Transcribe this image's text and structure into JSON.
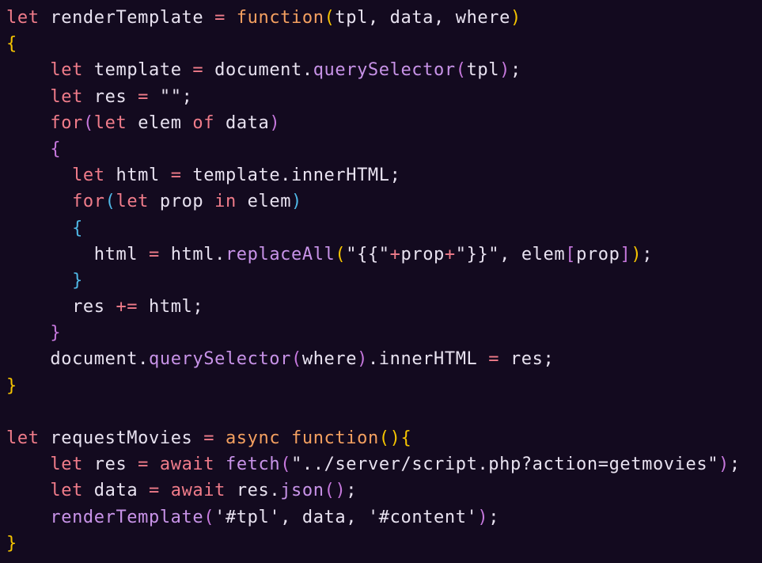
{
  "editor": {
    "lines": [
      [
        [
          "kw",
          "let"
        ],
        [
          "ws",
          " renderTemplate "
        ],
        [
          "op",
          "="
        ],
        [
          "ws",
          " "
        ],
        [
          "fn",
          "function"
        ],
        [
          "p1",
          "("
        ],
        [
          "id",
          "tpl, data, where"
        ],
        [
          "p1",
          ")"
        ]
      ],
      [
        [
          "p1",
          "{"
        ]
      ],
      [
        [
          "ws",
          "    "
        ],
        [
          "kw",
          "let"
        ],
        [
          "ws",
          " template "
        ],
        [
          "op",
          "="
        ],
        [
          "ws",
          " document."
        ],
        [
          "mth",
          "querySelector"
        ],
        [
          "p2",
          "("
        ],
        [
          "id",
          "tpl"
        ],
        [
          "p2",
          ")"
        ],
        [
          "id",
          ";"
        ]
      ],
      [
        [
          "ws",
          "    "
        ],
        [
          "kw",
          "let"
        ],
        [
          "ws",
          " res "
        ],
        [
          "op",
          "="
        ],
        [
          "ws",
          " "
        ],
        [
          "str",
          "\"\""
        ],
        [
          "id",
          ";"
        ]
      ],
      [
        [
          "ws",
          "    "
        ],
        [
          "kw",
          "for"
        ],
        [
          "p2",
          "("
        ],
        [
          "kw",
          "let"
        ],
        [
          "ws",
          " elem "
        ],
        [
          "kw",
          "of"
        ],
        [
          "ws",
          " data"
        ],
        [
          "p2",
          ")"
        ]
      ],
      [
        [
          "ws",
          "    "
        ],
        [
          "p2",
          "{"
        ]
      ],
      [
        [
          "ws",
          "      "
        ],
        [
          "kw",
          "let"
        ],
        [
          "ws",
          " html "
        ],
        [
          "op",
          "="
        ],
        [
          "ws",
          " template.innerHTML;"
        ]
      ],
      [
        [
          "ws",
          "      "
        ],
        [
          "kw",
          "for"
        ],
        [
          "p3",
          "("
        ],
        [
          "kw",
          "let"
        ],
        [
          "ws",
          " prop "
        ],
        [
          "kw",
          "in"
        ],
        [
          "ws",
          " elem"
        ],
        [
          "p3",
          ")"
        ]
      ],
      [
        [
          "ws",
          "      "
        ],
        [
          "p3",
          "{"
        ]
      ],
      [
        [
          "ws",
          "        html "
        ],
        [
          "op",
          "="
        ],
        [
          "ws",
          " html."
        ],
        [
          "mth",
          "replaceAll"
        ],
        [
          "p1",
          "("
        ],
        [
          "str",
          "\"{{\""
        ],
        [
          "op",
          "+"
        ],
        [
          "id",
          "prop"
        ],
        [
          "op",
          "+"
        ],
        [
          "str",
          "\"}}\""
        ],
        [
          "id",
          ", elem"
        ],
        [
          "p2",
          "["
        ],
        [
          "id",
          "prop"
        ],
        [
          "p2",
          "]"
        ],
        [
          "p1",
          ")"
        ],
        [
          "id",
          ";"
        ]
      ],
      [
        [
          "ws",
          "      "
        ],
        [
          "p3",
          "}"
        ]
      ],
      [
        [
          "ws",
          "      res "
        ],
        [
          "op",
          "+="
        ],
        [
          "ws",
          " html;"
        ]
      ],
      [
        [
          "ws",
          "    "
        ],
        [
          "p2",
          "}"
        ]
      ],
      [
        [
          "ws",
          "    document."
        ],
        [
          "mth",
          "querySelector"
        ],
        [
          "p2",
          "("
        ],
        [
          "id",
          "where"
        ],
        [
          "p2",
          ")"
        ],
        [
          "id",
          ".innerHTML "
        ],
        [
          "op",
          "="
        ],
        [
          "ws",
          " res;"
        ]
      ],
      [
        [
          "p1",
          "}"
        ]
      ],
      [
        [
          "ws",
          ""
        ]
      ],
      [
        [
          "kw",
          "let"
        ],
        [
          "ws",
          " requestMovies "
        ],
        [
          "op",
          "="
        ],
        [
          "ws",
          " "
        ],
        [
          "fn",
          "async function"
        ],
        [
          "p1",
          "()"
        ],
        [
          "p1",
          "{"
        ]
      ],
      [
        [
          "ws",
          "    "
        ],
        [
          "kw",
          "let"
        ],
        [
          "ws",
          " res "
        ],
        [
          "op",
          "="
        ],
        [
          "ws",
          " "
        ],
        [
          "kw",
          "await"
        ],
        [
          "ws",
          " "
        ],
        [
          "mth",
          "fetch"
        ],
        [
          "p2",
          "("
        ],
        [
          "str",
          "\"../server/script.php?action=getmovies\""
        ],
        [
          "p2",
          ")"
        ],
        [
          "id",
          ";"
        ]
      ],
      [
        [
          "ws",
          "    "
        ],
        [
          "kw",
          "let"
        ],
        [
          "ws",
          " data "
        ],
        [
          "op",
          "="
        ],
        [
          "ws",
          " "
        ],
        [
          "kw",
          "await"
        ],
        [
          "ws",
          " res."
        ],
        [
          "mth",
          "json"
        ],
        [
          "p2",
          "()"
        ],
        [
          "id",
          ";"
        ]
      ],
      [
        [
          "ws",
          "    "
        ],
        [
          "mth",
          "renderTemplate"
        ],
        [
          "p2",
          "("
        ],
        [
          "str",
          "'#tpl'"
        ],
        [
          "id",
          ", data, "
        ],
        [
          "str",
          "'#content'"
        ],
        [
          "p2",
          ")"
        ],
        [
          "id",
          ";"
        ]
      ],
      [
        [
          "p1",
          "}"
        ]
      ]
    ]
  }
}
